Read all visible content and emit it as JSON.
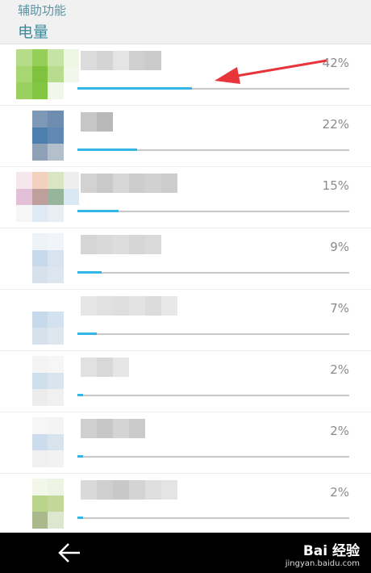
{
  "header": {
    "breadcrumb": "辅助功能",
    "title": "电量"
  },
  "rows": [
    {
      "percent": "42%",
      "usage": 0.42,
      "icon_colors": [
        "#b6db8a",
        "#95cf5a",
        "#c6e3a6",
        "#eef6e4",
        "#a8d670",
        "#7fc23e",
        "#b8dc8e",
        "#f2f7ec",
        "#9ad15e",
        "#83c644",
        "#f1f7ea",
        "#ffffff"
      ],
      "name_colors": [
        "#dcdcdc",
        "#d4d4d4",
        "#e4e4e4",
        "#cfcfcf",
        "#cbcbcb"
      ]
    },
    {
      "percent": "22%",
      "usage": 0.22,
      "icon_colors": [
        "#ffffff",
        "#7d97b7",
        "#6f8db0",
        "#ffffff",
        "#ffffff",
        "#4d7fac",
        "#6187b2",
        "#ffffff",
        "#ffffff",
        "#8ea1b6",
        "#b4bfcc",
        "#ffffff"
      ],
      "name_colors": [
        "#c6c6c6",
        "#b9b9b9"
      ]
    },
    {
      "percent": "15%",
      "usage": 0.15,
      "icon_colors": [
        "#f6e6ee",
        "#f2d2be",
        "#d8e6c6",
        "#eeeeee",
        "#e4bfd8",
        "#bf9f9c",
        "#96b59a",
        "#d9e8f2",
        "#f6f6f6",
        "#dfe9f4",
        "#e8eef4",
        "#ffffff"
      ],
      "name_colors": [
        "#d2d2d2",
        "#c9c9c9",
        "#d7d7d7",
        "#cdcdcd",
        "#d1d1d1",
        "#cccccc"
      ]
    },
    {
      "percent": "9%",
      "usage": 0.09,
      "icon_colors": [
        "#ffffff",
        "#eef3f8",
        "#f1f5f9",
        "#ffffff",
        "#ffffff",
        "#c5d9ea",
        "#d7e3ee",
        "#ffffff",
        "#ffffff",
        "#d6e1eb",
        "#dde6ee",
        "#ffffff"
      ],
      "name_colors": [
        "#d5d5d5",
        "#d9d9d9",
        "#dddddd",
        "#d6d6d6",
        "#dadada"
      ]
    },
    {
      "percent": "7%",
      "usage": 0.07,
      "icon_colors": [
        "#ffffff",
        "#ffffff",
        "#ffffff",
        "#ffffff",
        "#ffffff",
        "#c7daeb",
        "#d4e2ef",
        "#ffffff",
        "#ffffff",
        "#d6e1eb",
        "#dee6ee",
        "#ffffff"
      ],
      "name_colors": [
        "#e6e6e6",
        "#e1e1e1",
        "#dedede",
        "#e3e3e3",
        "#dcdcdc",
        "#e8e8e8"
      ]
    },
    {
      "percent": "2%",
      "usage": 0.02,
      "icon_colors": [
        "#ffffff",
        "#f4f4f4",
        "#f6f6f6",
        "#ffffff",
        "#ffffff",
        "#cfdeeb",
        "#dae4ee",
        "#ffffff",
        "#ffffff",
        "#ececec",
        "#f0f0f0",
        "#ffffff"
      ],
      "name_colors": [
        "#e1e1e1",
        "#d8d8d8",
        "#e6e6e6"
      ]
    },
    {
      "percent": "2%",
      "usage": 0.02,
      "icon_colors": [
        "#ffffff",
        "#f6f6f6",
        "#f4f4f4",
        "#ffffff",
        "#ffffff",
        "#ccdcec",
        "#d8e3ee",
        "#ffffff",
        "#ffffff",
        "#f0f0f0",
        "#f2f2f2",
        "#ffffff"
      ],
      "name_colors": [
        "#cfcfcf",
        "#c7c7c7",
        "#d4d4d4",
        "#cbcbcb"
      ]
    },
    {
      "percent": "2%",
      "usage": 0.02,
      "icon_colors": [
        "#ffffff",
        "#f2f7ea",
        "#eef4e4",
        "#ffffff",
        "#ffffff",
        "#b7d48a",
        "#c3d79b",
        "#ffffff",
        "#ffffff",
        "#a9b98c",
        "#dde6cf",
        "#ffffff"
      ],
      "name_colors": [
        "#d9d9d9",
        "#cfcfcf",
        "#c8c8c8",
        "#d4d4d4",
        "#dedede",
        "#e4e4e4"
      ]
    }
  ],
  "colors": {
    "accent": "#33b5e5",
    "arrow": "#e8353b",
    "title": "#3d8aa0"
  },
  "navbar": {
    "back_icon": "back-arrow-icon"
  },
  "watermark": {
    "main": "Bai 经验",
    "sub": "jingyan.baidu.com"
  }
}
